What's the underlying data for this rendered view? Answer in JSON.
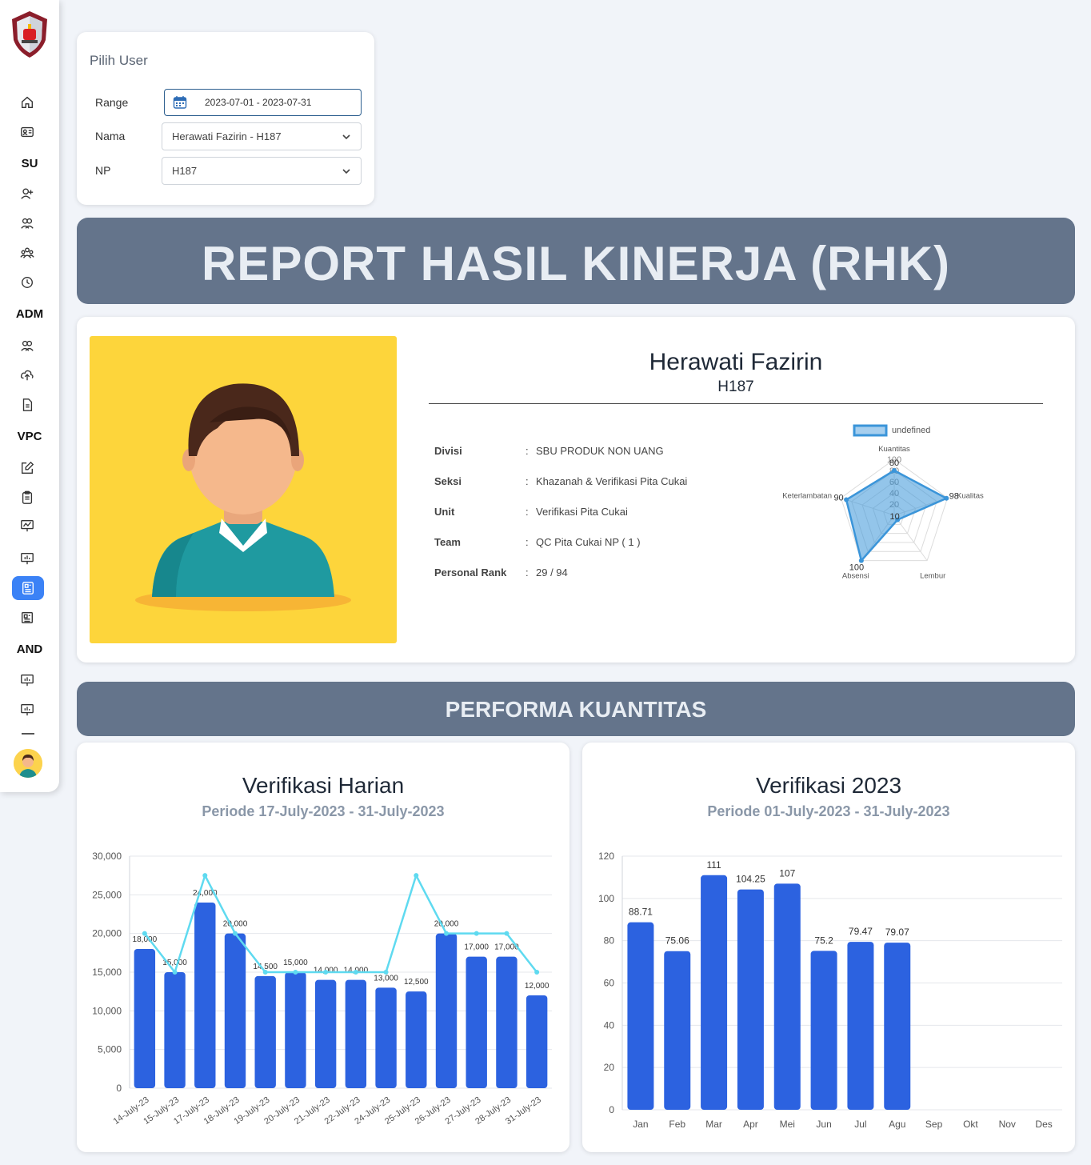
{
  "sidebar": {
    "sections": [
      "SU",
      "ADM",
      "VPC",
      "AND"
    ]
  },
  "filter": {
    "title": "Pilih User",
    "range_label": "Range",
    "range_value": "2023-07-01 - 2023-07-31",
    "nama_label": "Nama",
    "nama_value": "Herawati Fazirin - H187",
    "np_label": "NP",
    "np_value": "H187"
  },
  "report_title": "REPORT HASIL KINERJA (RHK)",
  "profile": {
    "name": "Herawati Fazirin",
    "np": "H187",
    "rows": [
      {
        "label": "Divisi",
        "value": "SBU PRODUK NON UANG"
      },
      {
        "label": "Seksi",
        "value": "Khazanah & Verifikasi Pita Cukai"
      },
      {
        "label": "Unit",
        "value": "Verifikasi Pita Cukai"
      },
      {
        "label": "Team",
        "value": "QC Pita Cukai NP ( 1 )"
      },
      {
        "label": "Personal Rank",
        "value": "29 / 94"
      }
    ]
  },
  "section_title": "PERFORMA KUANTITAS",
  "daily": {
    "title": "Verifikasi Harian",
    "subtitle": "Periode 17-July-2023 - 31-July-2023"
  },
  "yearly": {
    "title": "Verifikasi 2023",
    "subtitle": "Periode 01-July-2023 - 31-July-2023"
  },
  "colors": {
    "bar": "#2c62e0",
    "line": "#5fdaf0",
    "radar": "#3b95d9",
    "banner": "#64748b"
  },
  "chart_data": [
    {
      "type": "radar",
      "legend": [
        "undefined"
      ],
      "axes": [
        "Kuantitas",
        "Kualitas",
        "Lembur",
        "Absensi",
        "Keterlambatan"
      ],
      "values": [
        80,
        98,
        10,
        100,
        90
      ],
      "ticks": [
        20,
        40,
        60,
        80,
        100
      ],
      "rmax": 100
    },
    {
      "type": "bar",
      "categories": [
        "14-July-23",
        "15-July-23",
        "17-July-23",
        "18-July-23",
        "19-July-23",
        "20-July-23",
        "21-July-23",
        "22-July-23",
        "24-July-23",
        "25-July-23",
        "26-July-23",
        "27-July-23",
        "28-July-23",
        "31-July-23"
      ],
      "values": [
        18000,
        15000,
        24000,
        20000,
        14500,
        15000,
        14000,
        14000,
        13000,
        12500,
        20000,
        17000,
        17000,
        12000
      ],
      "labels": [
        "18,000",
        "15,000",
        "24,000",
        "20,000",
        "14,500",
        "15,000",
        "14,000",
        "14,000",
        "13,000",
        "12,500",
        "20,000",
        "17,000",
        "17,000",
        "12,000"
      ],
      "line": [
        20000,
        15000,
        27500,
        20000,
        15000,
        15000,
        15000,
        15000,
        15000,
        27500,
        20000,
        20000,
        20000,
        15000
      ],
      "ylim": [
        0,
        30000
      ],
      "yticks": [
        "0",
        "5,000",
        "10,000",
        "15,000",
        "20,000",
        "25,000",
        "30,000"
      ]
    },
    {
      "type": "bar",
      "categories": [
        "Jan",
        "Feb",
        "Mar",
        "Apr",
        "Mei",
        "Jun",
        "Jul",
        "Agu",
        "Sep",
        "Okt",
        "Nov",
        "Des"
      ],
      "values": [
        88.71,
        75.06,
        111,
        104.25,
        107,
        75.2,
        79.47,
        79.07,
        null,
        null,
        null,
        null
      ],
      "labels": [
        "88.71",
        "75.06",
        "111",
        "104.25",
        "107",
        "75.2",
        "79.47",
        "79.07",
        "",
        "",
        "",
        ""
      ],
      "ylim": [
        0,
        120
      ],
      "yticks": [
        "0",
        "20",
        "40",
        "60",
        "80",
        "100",
        "120"
      ]
    }
  ]
}
